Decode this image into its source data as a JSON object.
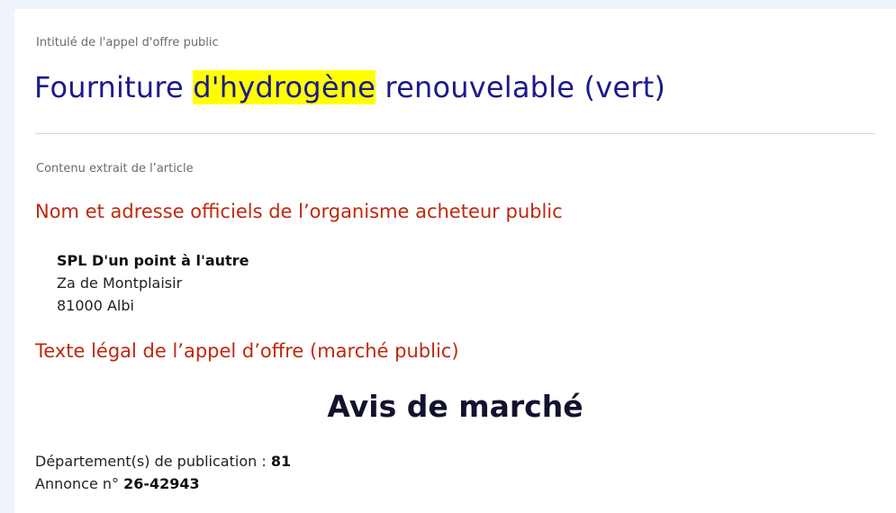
{
  "tender": {
    "title_label": "Intitulé de l'appel d'offre public",
    "title_before": "Fourniture ",
    "title_highlight": "d'hydrogène",
    "title_after": " renouvelable (vert)",
    "highlight_color": "#ffff00",
    "title_color": "#1a1a8c"
  },
  "content": {
    "label": "Contenu extrait de l’article",
    "section_color": "#c0270e",
    "buyer_section_title": "Nom et adresse officiels de l’organisme acheteur public",
    "buyer": {
      "name": "SPL D'un point à l'autre",
      "street": "Za de Montplaisir",
      "city": "81000 Albi"
    },
    "legal_section_title": "Texte légal de l’appel d’offre (marché public)",
    "notice_title": "Avis de marché",
    "departments_label": "Département(s) de publication : ",
    "departments_value": "81",
    "announcement_label": "Annonce n° ",
    "announcement_value": "26-42943"
  }
}
